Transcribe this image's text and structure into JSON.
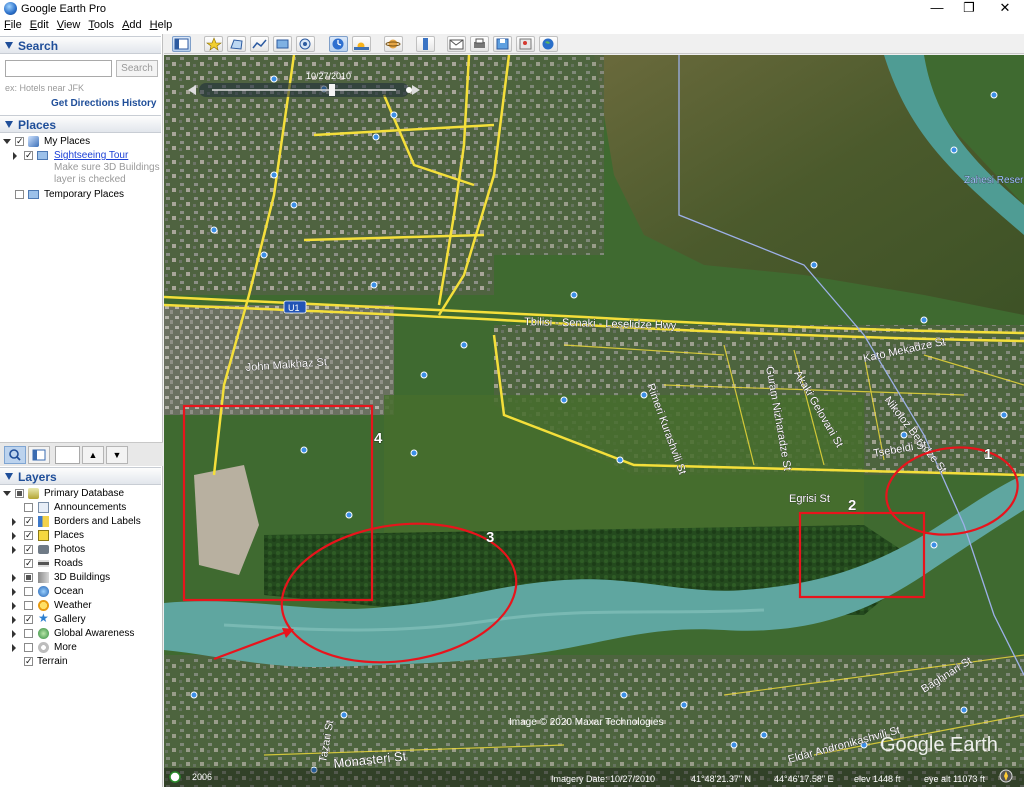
{
  "window": {
    "title": "Google Earth Pro",
    "minimize": "—",
    "maximize": "❐",
    "close": "✕"
  },
  "menu": [
    "File",
    "Edit",
    "View",
    "Tools",
    "Add",
    "Help"
  ],
  "search": {
    "header": "Search",
    "placeholder": "",
    "button": "Search",
    "hint": "ex: Hotels near JFK",
    "get_directions": "Get Directions",
    "history": "History"
  },
  "places": {
    "header": "Places",
    "my_places": "My Places",
    "sightseeing_tour": "Sightseeing Tour",
    "tour_note_1": "Make sure 3D Buildings",
    "tour_note_2": "layer is checked",
    "temporary_places": "Temporary Places"
  },
  "layers": {
    "header": "Layers",
    "items": [
      {
        "label": "Primary Database",
        "checked": "partial",
        "icon": "globe-db-icon"
      },
      {
        "label": "Announcements",
        "checked": false,
        "icon": "announcement-icon"
      },
      {
        "label": "Borders and Labels",
        "checked": true,
        "icon": "borders-icon"
      },
      {
        "label": "Places",
        "checked": true,
        "icon": "places-icon"
      },
      {
        "label": "Photos",
        "checked": true,
        "icon": "photos-icon"
      },
      {
        "label": "Roads",
        "checked": true,
        "icon": "roads-icon"
      },
      {
        "label": "3D Buildings",
        "checked": "partial",
        "icon": "buildings-icon"
      },
      {
        "label": "Ocean",
        "checked": false,
        "icon": "ocean-icon"
      },
      {
        "label": "Weather",
        "checked": false,
        "icon": "weather-icon"
      },
      {
        "label": "Gallery",
        "checked": true,
        "icon": "gallery-icon"
      },
      {
        "label": "Global Awareness",
        "checked": false,
        "icon": "global-awareness-icon"
      },
      {
        "label": "More",
        "checked": false,
        "icon": "more-icon"
      },
      {
        "label": "Terrain",
        "checked": true,
        "icon": ""
      }
    ]
  },
  "map": {
    "timeline_date": "10/27/2010",
    "road_labels": {
      "tbilisi": "Tbilisi - Senaki - Leselidze Hwy",
      "u1": "U1",
      "kato_mekadze": "Kato Mekadze St",
      "nikoloz_beradze": "Nikoloz Beradze St",
      "akaki_gelovani": "Akaki Gelovani St",
      "guram_nizharadze": "Guram Nizharadze St",
      "rimeri_kurashvili": "Rimeri Kurashvili St",
      "tsebeldi": "Tsebeldi St",
      "egrisi": "Egrisi St",
      "john_malkhaz": "John Malkhaz St",
      "baghnari": "Baghnari St",
      "andronikashvili": "Eldar Andronikashvili St",
      "tazari": "Tazari St",
      "monasteri": "Monasteri St",
      "zahesi": "Zahesi Reser"
    },
    "annotations": [
      "1",
      "2",
      "3",
      "4"
    ],
    "copyright": "Image © 2020 Maxar Technologies",
    "brand": "Google Earth",
    "year_badge": "2006",
    "status": {
      "imagery_date": "Imagery Date: 10/27/2010",
      "lat": "41°48'21.37\" N",
      "lon": "44°46'17.58\" E",
      "elev": "elev  1448 ft",
      "eye_alt": "eye alt  11073 ft"
    },
    "colors": {
      "annotation_red": "#e8141c",
      "road_yellow": "#f4df3a",
      "river": "#5fa6a0"
    }
  }
}
